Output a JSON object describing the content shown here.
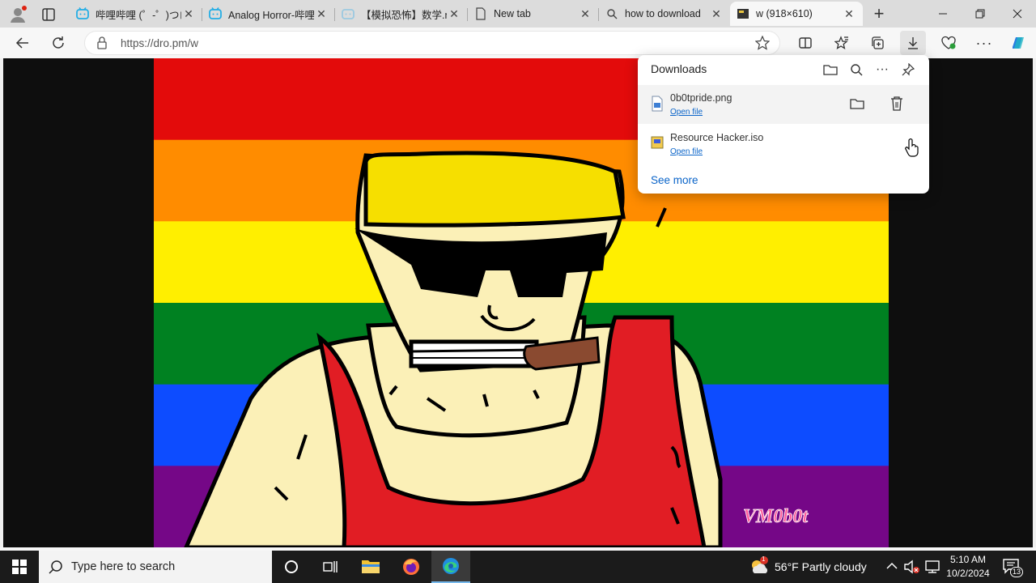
{
  "tabs": [
    {
      "title": "哔哩哔哩 (゜-゜)つロ",
      "icon": "bilibili-icon"
    },
    {
      "title": "Analog Horror-哔哩",
      "icon": "bilibili-icon"
    },
    {
      "title": "【模拟恐怖】数学.mp",
      "icon": "bilibili-icon"
    },
    {
      "title": "New tab",
      "icon": "page-icon"
    },
    {
      "title": "how to download",
      "icon": "search-icon"
    },
    {
      "title": "w (918×610)",
      "icon": "image-thumbnail-icon",
      "active": true
    }
  ],
  "address": {
    "url": "https://dro.pm/w"
  },
  "downloads": {
    "title": "Downloads",
    "items": [
      {
        "name": "0b0tpride.png",
        "action": "Open file"
      },
      {
        "name": "Resource Hacker.iso",
        "action": "Open file"
      }
    ],
    "see_more": "See more"
  },
  "image": {
    "signature": "VM0b0t",
    "stripe_colors": [
      "#e30b0b",
      "#ff8c00",
      "#ffef00",
      "#008121",
      "#0d4cff",
      "#750787"
    ]
  },
  "taskbar": {
    "search_placeholder": "Type here to search",
    "weather": "56°F  Partly cloudy",
    "weather_badge": "1",
    "time": "5:10 AM",
    "date": "10/2/2024",
    "notifications": "13"
  }
}
